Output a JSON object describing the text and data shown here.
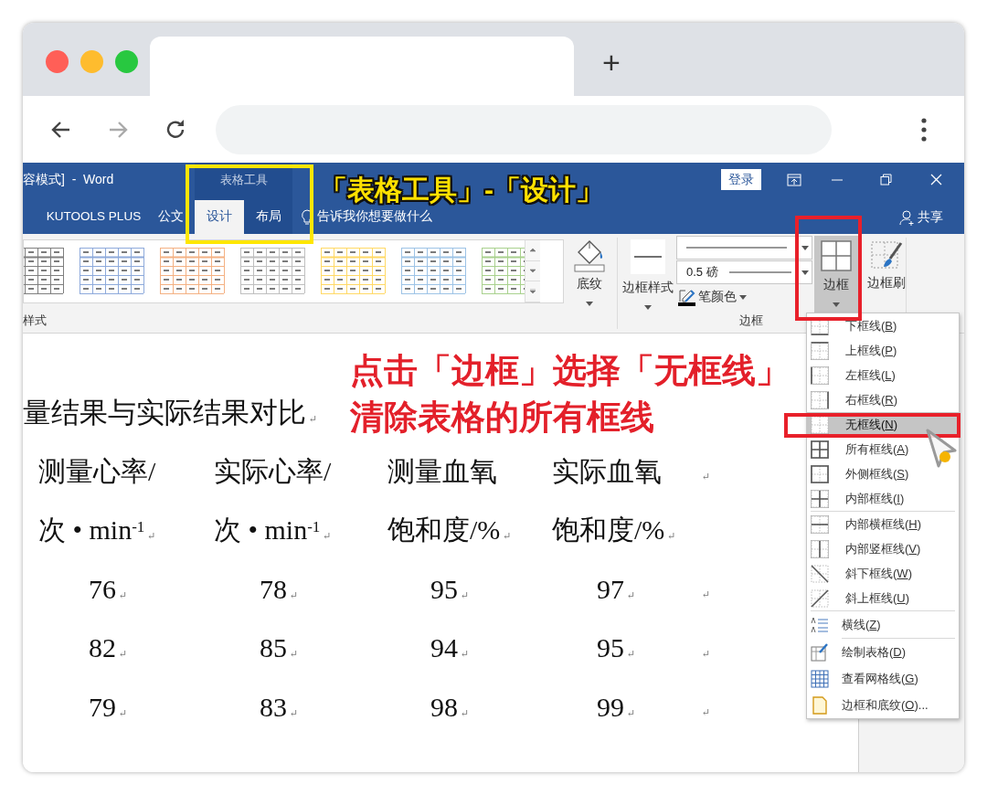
{
  "browser": {
    "new_tab_label": "+"
  },
  "word": {
    "title": "容模式]  -  Word",
    "tell_me": "告诉我你想要做什么",
    "sign_in": "登录",
    "share": "共享",
    "tabs": [
      {
        "label": "KUTOOLS PLUS",
        "selected": false
      },
      {
        "label": "公文",
        "selected": false
      }
    ],
    "context_group": {
      "label": "表格工具",
      "tabs": [
        {
          "label": "设计",
          "selected": true
        },
        {
          "label": "布局",
          "selected": false
        }
      ]
    }
  },
  "ribbon": {
    "gallery": [
      {
        "color": "#7f7f7f"
      },
      {
        "color": "#8eaadb"
      },
      {
        "color": "#f4b183"
      },
      {
        "color": "#bfbfbf"
      },
      {
        "color": "#ffd966"
      },
      {
        "color": "#9dc3e6"
      },
      {
        "color": "#a9d18e"
      }
    ],
    "shading": "底纹",
    "border_styles": "边框样式",
    "line_weight": "0.5 磅",
    "pen_color": "笔颜色",
    "borders": {
      "label": "边框",
      "pressed": true
    },
    "border_painter": "边框刷",
    "groups": [
      "样式",
      "边框"
    ]
  },
  "document": {
    "heading": "量结果与实际结果对比",
    "heading_mark": "↵",
    "rows": [
      {
        "kind": "header",
        "cells": [
          {
            "text": "测量心率/"
          },
          {
            "text": "实际心率/"
          },
          {
            "text": "测量血氧"
          },
          {
            "text": "实际血氧"
          }
        ],
        "end_mark": "↵"
      },
      {
        "kind": "header",
        "cells": [
          {
            "text": "次 • min$^{-1}$",
            "mark": "↵"
          },
          {
            "text": "次 • min$^{-1}$",
            "mark": "↵"
          },
          {
            "text": "饱和度/%",
            "mark": "↵"
          },
          {
            "text": "饱和度/%",
            "mark": "↵"
          }
        ]
      },
      {
        "kind": "value",
        "cells": [
          {
            "text": "76",
            "mark": "↵"
          },
          {
            "text": "78",
            "mark": "↵"
          },
          {
            "text": "95",
            "mark": "↵"
          },
          {
            "text": "97",
            "mark": "↵"
          }
        ],
        "end_mark": "↵"
      },
      {
        "kind": "value",
        "cells": [
          {
            "text": "82",
            "mark": "↵"
          },
          {
            "text": "85",
            "mark": "↵"
          },
          {
            "text": "94",
            "mark": "↵"
          },
          {
            "text": "95",
            "mark": "↵"
          }
        ],
        "end_mark": "↵"
      },
      {
        "kind": "value",
        "cells": [
          {
            "text": "79",
            "mark": "↵"
          },
          {
            "text": "83",
            "mark": "↵"
          },
          {
            "text": "98",
            "mark": "↵"
          },
          {
            "text": "99",
            "mark": "↵"
          }
        ],
        "end_mark": "↵"
      }
    ]
  },
  "border_menu": {
    "items": [
      {
        "kind": "bottom",
        "before": "下框线(",
        "key": "B",
        "after": ")",
        "selected": false,
        "separator_before": false
      },
      {
        "kind": "top",
        "before": "上框线(",
        "key": "P",
        "after": ")",
        "selected": false,
        "separator_before": false
      },
      {
        "kind": "left",
        "before": "左框线(",
        "key": "L",
        "after": ")",
        "selected": false,
        "separator_before": false
      },
      {
        "kind": "right",
        "before": "右框线(",
        "key": "R",
        "after": ")",
        "selected": false,
        "separator_before": false
      },
      {
        "kind": "none",
        "before": "无框线(",
        "key": "N",
        "after": ")",
        "selected": true,
        "separator_before": false
      },
      {
        "kind": "all",
        "before": "所有框线(",
        "key": "A",
        "after": ")",
        "selected": false,
        "separator_before": false
      },
      {
        "kind": "outside",
        "before": "外侧框线(",
        "key": "S",
        "after": ")",
        "selected": false,
        "separator_before": false
      },
      {
        "kind": "inside",
        "before": "内部框线(",
        "key": "I",
        "after": ")",
        "selected": false,
        "separator_before": false
      },
      {
        "kind": "inside-h",
        "before": "内部横框线(",
        "key": "H",
        "after": ")",
        "selected": false,
        "separator_before": true
      },
      {
        "kind": "inside-v",
        "before": "内部竖框线(",
        "key": "V",
        "after": ")",
        "selected": false,
        "separator_before": false
      },
      {
        "kind": "diag-down",
        "before": "斜下框线(",
        "key": "W",
        "after": ")",
        "selected": false,
        "separator_before": false
      },
      {
        "kind": "diag-up",
        "before": "斜上框线(",
        "key": "U",
        "after": ")",
        "selected": false,
        "separator_before": false
      },
      {
        "kind": "hline",
        "before": "横线(",
        "key": "Z",
        "after": ")",
        "selected": false,
        "separator_before": true
      },
      {
        "kind": "draw",
        "before": "绘制表格(",
        "key": "D",
        "after": ")",
        "selected": false,
        "separator_before": true
      },
      {
        "kind": "grid",
        "before": "查看网格线(",
        "key": "G",
        "after": ")",
        "selected": false,
        "separator_before": false
      },
      {
        "kind": "page",
        "before": "边框和底纹(",
        "key": "O",
        "after": ")...",
        "selected": false,
        "separator_before": false
      }
    ]
  },
  "annotations": [
    {
      "kind": "caption",
      "text": "「表格工具」-「设计」"
    },
    {
      "kind": "callout",
      "text": "点击「边框」选择「无框线」"
    },
    {
      "kind": "callout",
      "text": "清除表格的所有框线"
    }
  ]
}
